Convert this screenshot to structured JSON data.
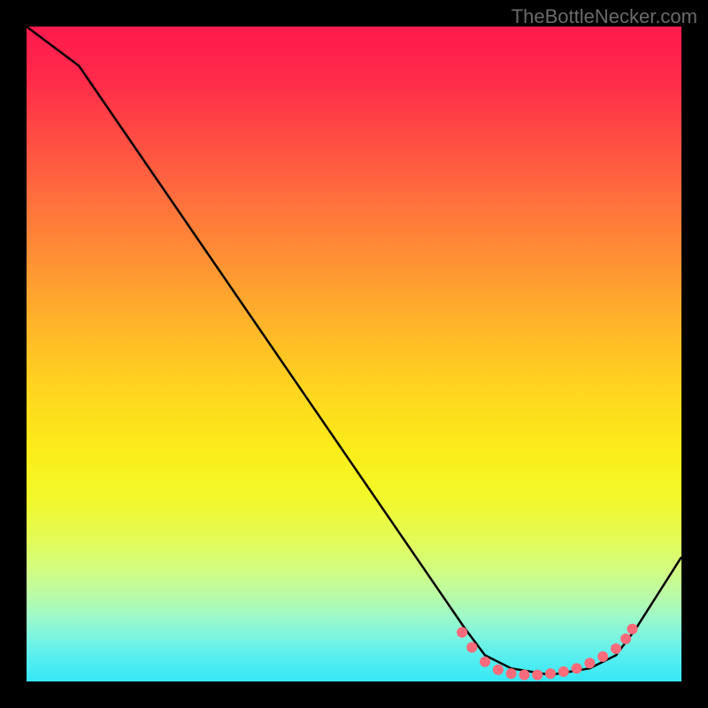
{
  "watermark": "TheBottleNecker.com",
  "chart_data": {
    "type": "line",
    "title": "",
    "xlabel": "",
    "ylabel": "",
    "xlim": [
      0,
      1
    ],
    "ylim": [
      0,
      1
    ],
    "series": [
      {
        "name": "curve",
        "points": [
          {
            "x": 0.0,
            "y": 1.0
          },
          {
            "x": 0.08,
            "y": 0.94
          },
          {
            "x": 0.67,
            "y": 0.08
          },
          {
            "x": 0.7,
            "y": 0.04
          },
          {
            "x": 0.74,
            "y": 0.02
          },
          {
            "x": 0.8,
            "y": 0.01
          },
          {
            "x": 0.86,
            "y": 0.02
          },
          {
            "x": 0.9,
            "y": 0.04
          },
          {
            "x": 0.93,
            "y": 0.08
          },
          {
            "x": 1.0,
            "y": 0.19
          }
        ]
      }
    ],
    "markers": [
      {
        "x": 0.665,
        "y": 0.075
      },
      {
        "x": 0.68,
        "y": 0.052
      },
      {
        "x": 0.7,
        "y": 0.03
      },
      {
        "x": 0.72,
        "y": 0.018
      },
      {
        "x": 0.74,
        "y": 0.012
      },
      {
        "x": 0.76,
        "y": 0.01
      },
      {
        "x": 0.78,
        "y": 0.01
      },
      {
        "x": 0.8,
        "y": 0.012
      },
      {
        "x": 0.82,
        "y": 0.015
      },
      {
        "x": 0.84,
        "y": 0.02
      },
      {
        "x": 0.86,
        "y": 0.028
      },
      {
        "x": 0.88,
        "y": 0.038
      },
      {
        "x": 0.9,
        "y": 0.05
      },
      {
        "x": 0.915,
        "y": 0.065
      },
      {
        "x": 0.925,
        "y": 0.08
      }
    ],
    "colors": {
      "curve": "#000000",
      "marker": "#ff6b7a",
      "gradient_top": "#ff1a4d",
      "gradient_bottom": "#36e7f6"
    }
  }
}
